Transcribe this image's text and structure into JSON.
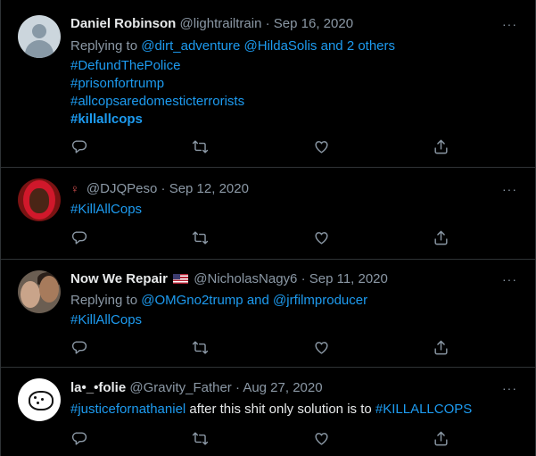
{
  "tweets": [
    {
      "name": "Daniel Robinson",
      "handle": "@lightrailtrain",
      "separator": "·",
      "date": "Sep 16, 2020",
      "reply_prefix": "Replying to ",
      "reply_mentions": "@dirt_adventure @HildaSolis",
      "reply_joiner": " and ",
      "reply_others": "2 others",
      "hashtags": [
        "#DefundThePolice",
        "#prisonfortrump",
        "#allcopsaredomesticterrorists",
        "#killallcops"
      ]
    },
    {
      "name": "",
      "name_icon": "dancer-emoji",
      "handle": "@DJQPeso",
      "separator": "·",
      "date": "Sep 12, 2020",
      "hashtag": "#KillAllCops"
    },
    {
      "name": "Now We Repair",
      "name_icon": "us-flag-emoji",
      "handle": "@NicholasNagy6",
      "separator": "·",
      "date": "Sep 11, 2020",
      "reply_prefix": "Replying to ",
      "reply_mention_1": "@OMGno2trump",
      "reply_joiner": " and ",
      "reply_mention_2": "@jrfilmproducer",
      "hashtag": "#KillAllCops"
    },
    {
      "name": "la•_•folie",
      "handle": "@Gravity_Father",
      "separator": "·",
      "date": "Aug 27, 2020",
      "hashtag_1": "#justicefornathaniel",
      "text": " after this shit only solution is to ",
      "hashtag_2": "#KILLALLCOPS"
    }
  ],
  "more_label": "···",
  "action_icons": [
    "reply-icon",
    "retweet-icon",
    "like-icon",
    "share-icon"
  ],
  "colors": {
    "background": "#000000",
    "link": "#1d9bf0",
    "muted": "#8b98a5",
    "divider": "#2f3336"
  }
}
